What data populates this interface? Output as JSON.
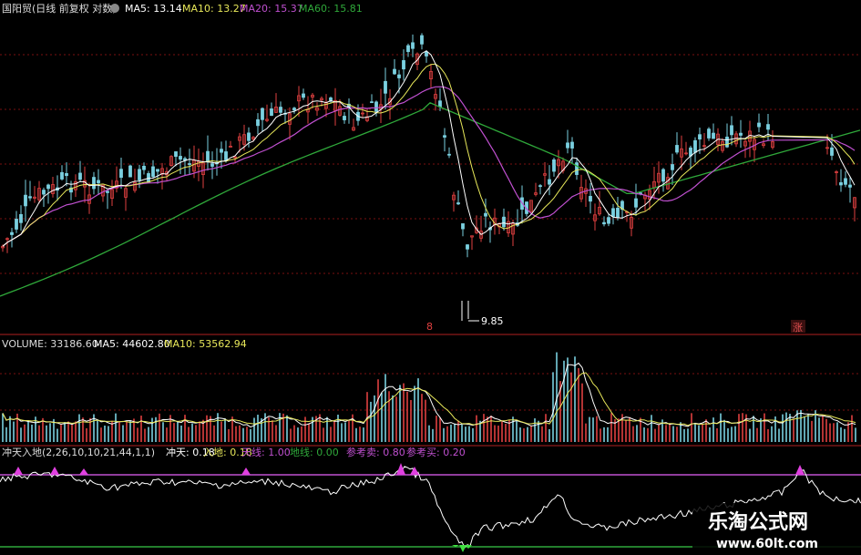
{
  "price_panel": {
    "title": "国阳贸(日线 前复权 对数)",
    "ma5_label": "MA5: 13.14",
    "ma10_label": "MA10: 13.27",
    "ma20_label": "MA20: 15.37",
    "ma60_label": "MA60: 15.81",
    "low_marker": "9.85",
    "left_mark": "8",
    "right_mark": "涨",
    "colors": {
      "ma5": "#ffffff",
      "ma10": "#e8e85a",
      "ma20": "#c050d0",
      "ma60": "#2fa83a",
      "up": "#e04040",
      "down": "#7ad0e0"
    }
  },
  "volume_panel": {
    "vol_label": "VOLUME: 33186.60",
    "ma5_label": "MA5: 44602.80",
    "ma10_label": "MA10: 53562.94"
  },
  "indicator_panel": {
    "name_label": "冲天入地(2,26,10,10,21,44,1,1)",
    "chongtian_label": "冲天: 0.18",
    "rudi_label": "入地: 0.18",
    "tianxian_label": "天线: 1.00",
    "dixian_label": "地线: 0.00",
    "sell_label": "参考卖: 0.80",
    "buy_label": "参考买: 0.20",
    "colors": {
      "line": "#ffffff",
      "upper": "#c050d0",
      "lower": "#2fa83a",
      "signal_top": "#e040e0",
      "signal_bottom": "#40e040"
    }
  },
  "watermark": {
    "title": "乐淘公式网",
    "url": "www.60lt.com"
  }
}
